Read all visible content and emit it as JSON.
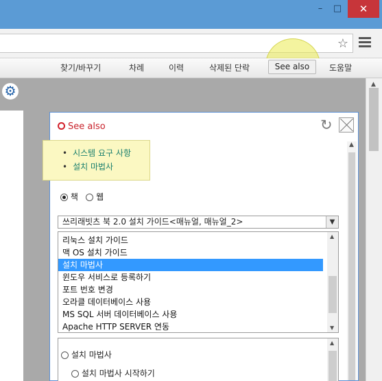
{
  "window": {
    "minimize_label": "–",
    "maximize_label": "□",
    "close_label": "✕"
  },
  "address_bar": {
    "value": ""
  },
  "help_toolbar": {
    "items": [
      "찾기/바꾸기",
      "차례",
      "이력",
      "삭제된 단락",
      "See also",
      "도움말"
    ],
    "highlighted_item": "See also"
  },
  "panel": {
    "title": "See also",
    "see_also_links": [
      "시스템 요구 사항",
      "설치 마법사"
    ],
    "radio_options": [
      "책",
      "웹"
    ],
    "radio_selected": "책",
    "book_select_value": "쓰리래빗츠 북 2.0 설치 가이드<매뉴얼, 매뉴얼_2>",
    "topics": [
      "리눅스 설치 가이드",
      "맥 OS 설치 가이드",
      "설치 마법사",
      "윈도우 서비스로 등록하기",
      "포트 번호 변경",
      "오라클 데이터베이스 사용",
      "MS SQL 서버 데이터베이스 사용",
      "Apache HTTP SERVER 연동"
    ],
    "selected_topic": "설치 마법사",
    "sub_items": [
      "설치 마법사",
      "설치 마법사 시작하기"
    ]
  },
  "colors": {
    "titlebar": "#5b9bd5",
    "close_button": "#c7353a",
    "panel_title": "#c8202a",
    "link": "#1a7f6e",
    "selection": "#3399ff",
    "highlight": "#fbf8c2"
  }
}
